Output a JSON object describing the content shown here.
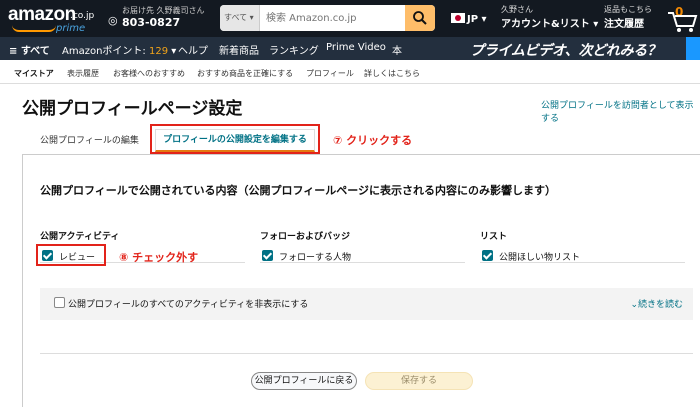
{
  "header": {
    "logo": {
      "word": "amazon",
      "tld": ".co.jp",
      "sub": "prime"
    },
    "deliver": {
      "line1": "お届け先 久野義司さん",
      "line2": "803-0827"
    },
    "search": {
      "category": "すべて ▾",
      "placeholder": "検索 Amazon.co.jp"
    },
    "language": "JP ▾",
    "account": {
      "line1": "久野さん",
      "line2": "アカウント&リスト ▾"
    },
    "orders": {
      "line1": "返品もこちら",
      "line2": "注文履歴"
    },
    "cart_count": "0"
  },
  "subnav": {
    "all": "≡ すべて",
    "points_label": "Amazonポイント: ",
    "points_value": "129",
    "points_caret": " ▾",
    "help": "ヘルプ",
    "new": "新着商品",
    "ranking": "ランキング",
    "prime_video": "Prime Video",
    "books": "本",
    "banner": "プライムビデオ、次どれみる？"
  },
  "sublinks": [
    "マイストア",
    "表示履歴",
    "お客様へのおすすめ",
    "おすすめ商品を正確にする",
    "プロフィール",
    "詳しくはこちら"
  ],
  "page": {
    "title": "公開プロフィールページ設定",
    "visitor_link": "公開プロフィールを訪問者として表示する",
    "tab_edit": "公開プロフィールの編集",
    "tab_settings": "プロフィールの公開設定を編集する",
    "step7": "⑦ クリックする",
    "step8": "⑧ チェック外す",
    "section_heading": "公開プロフィールで公開されている内容（公開プロフィールページに表示される内容にのみ影響します）",
    "columns": [
      {
        "heading": "公開アクティビティ",
        "item": "レビュー",
        "checked": true
      },
      {
        "heading": "フォローおよびバッジ",
        "item": "フォローする人物",
        "checked": true
      },
      {
        "heading": "リスト",
        "item": "公開ほしい物リスト",
        "checked": true
      }
    ],
    "hide_all": "公開プロフィールのすべてのアクティビティを非表示にする",
    "read_more": "続きを読む",
    "back_button": "公開プロフィールに戻る",
    "save_button": "保存する"
  },
  "colors": {
    "nav_dark": "#131921",
    "nav_sub": "#232f3e",
    "accent": "#ff9900",
    "link": "#007185",
    "annotation": "#e2231a"
  }
}
